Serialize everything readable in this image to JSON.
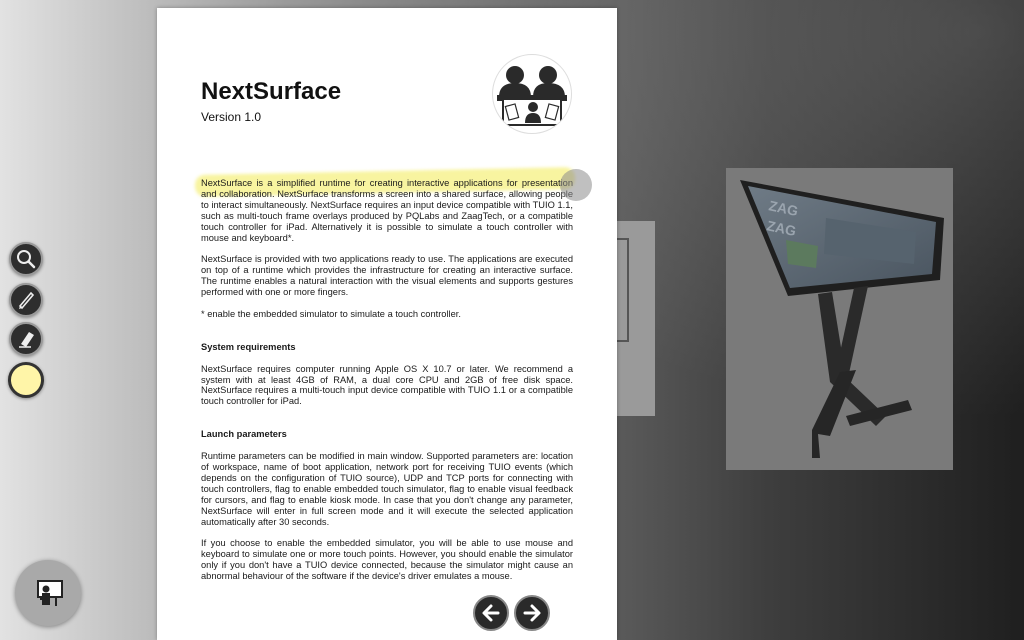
{
  "document": {
    "title": "NextSurface",
    "version": "Version 1.0",
    "paragraphs": {
      "intro": "NextSurface is a simplified runtime for creating interactive applications for presentation and collaboration. NextSurface transforms a screen into a shared surface, allowing people to interact simultaneously. NextSurface requires an input device compatible with TUIO 1.1, such as multi-touch frame overlays produced by PQLabs and ZaagTech, or a compatible touch controller for iPad. Alternatively it is possible to simulate a touch controller with mouse and keyboard*.",
      "apps": "NextSurface is provided with two applications ready to use. The applications are executed on top of a runtime which provides the infrastructure for creating an interactive surface. The runtime enables a natural interaction with the visual elements and supports gestures performed with one or more fingers.",
      "footnote": "* enable the embedded simulator to simulate a touch controller.",
      "requirements": "NextSurface requires computer running Apple OS X 10.7 or later. We recommend a system with at least 4GB of RAM, a dual core CPU and 2GB of free disk space. NextSurface requires a multi-touch input device compatible with TUIO 1.1 or a compatible touch controller for iPad.",
      "launch": "Runtime parameters can be modified in main window. Supported parameters are: location of workspace, name of boot application, network port for receiving TUIO events (which depends on the configuration of TUIO source), UDP and TCP ports for connecting with touch controllers, flag to enable embedded touch simulator, flag to enable visual feedback for cursors, and flag to enable kiosk mode. In case that you don't change any parameter, NextSurface will enter in full screen mode and it will execute the selected application automatically after 30 seconds.",
      "simulator": "If you choose to enable the embedded simulator, you will be able to use mouse and keyboard to simulate one or more touch points. However, you should enable the simulator only if you don't have a TUIO device connected, because the simulator might cause an abnormal behaviour of the software if the device's driver emulates a mouse."
    },
    "headings": {
      "requirements": "System requirements",
      "launch": "Launch parameters"
    }
  },
  "tools": [
    {
      "name": "magnifier",
      "icon": "magnifier-icon"
    },
    {
      "name": "pencil",
      "icon": "pencil-icon"
    },
    {
      "name": "eraser",
      "icon": "eraser-icon"
    },
    {
      "name": "color",
      "icon": "color-swatch",
      "color": "#fff5a8"
    }
  ],
  "navigation": {
    "prev_icon": "arrow-left-icon",
    "next_icon": "arrow-right-icon"
  },
  "colors": {
    "highlight": "#f5f078",
    "tool_bg": "#2e2e2e"
  }
}
